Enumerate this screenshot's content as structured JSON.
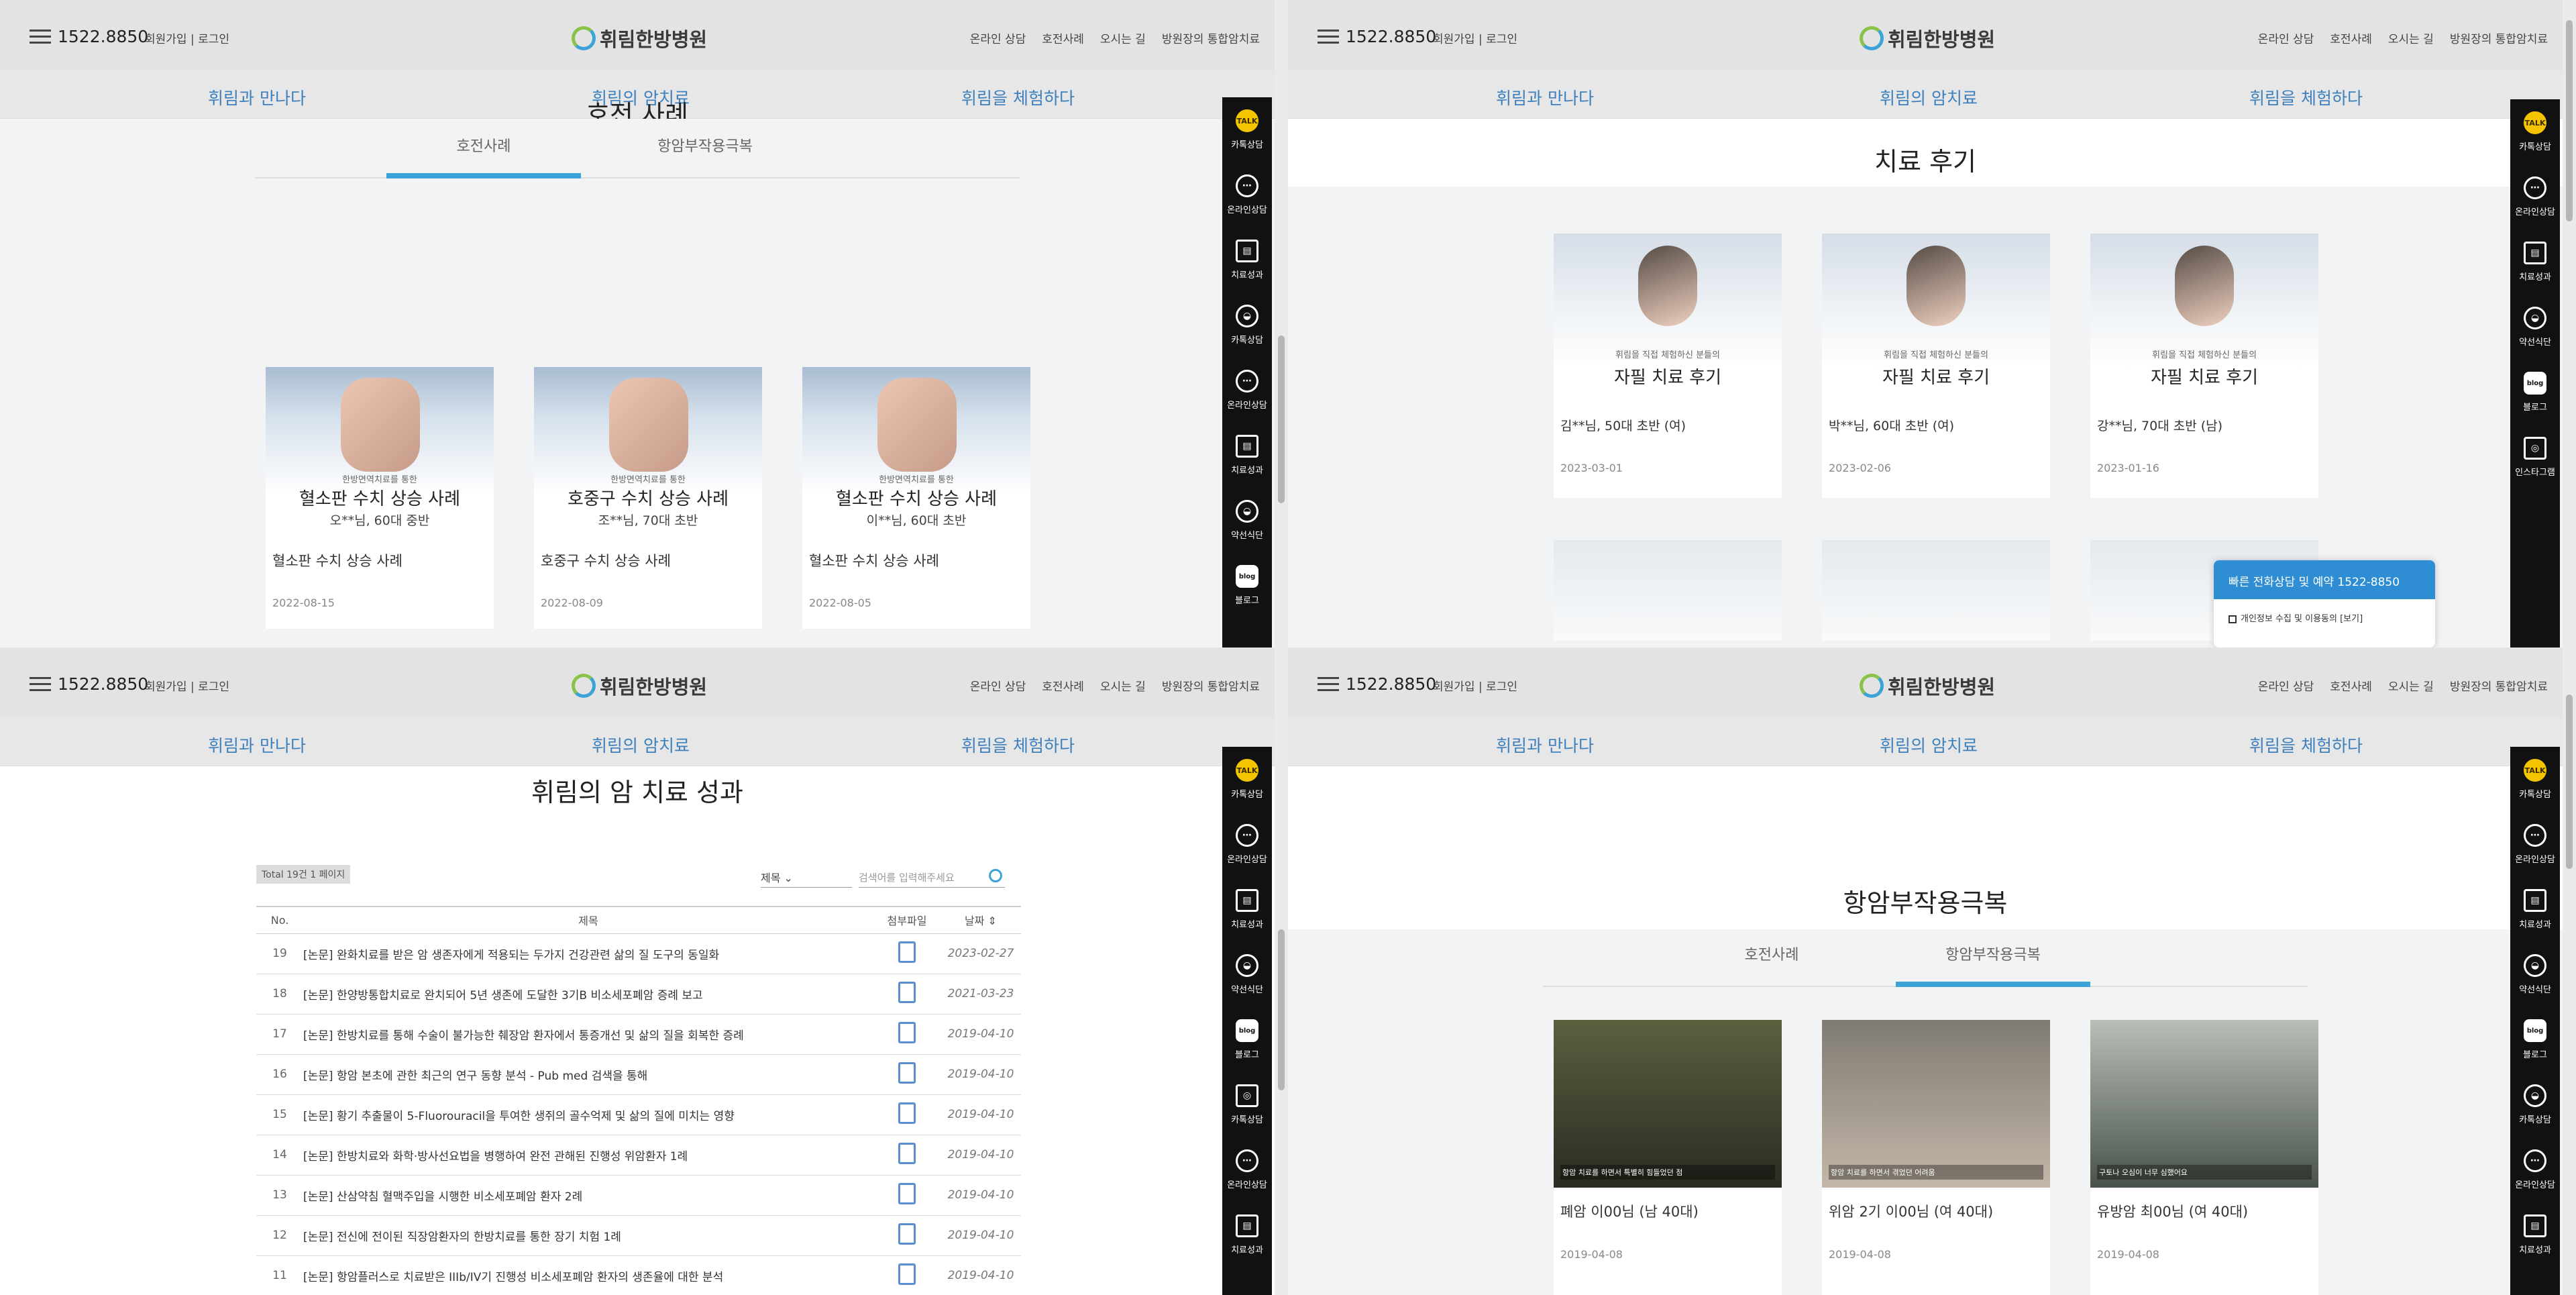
{
  "header": {
    "phone": "1522.8850",
    "member": "회원가입 | 로그인",
    "logo": "휘림한방병원",
    "logo_mark": "leaf-circle-logo",
    "top_links": [
      "온라인 상담",
      "호전사례",
      "오시는 길",
      "방원장의 통합암치료"
    ],
    "main_nav": [
      "휘림과 만나다",
      "휘림의 암치료",
      "휘림을 체험하다"
    ]
  },
  "sidebar": {
    "items": [
      {
        "icon": "TALK",
        "label": "카톡상담"
      },
      {
        "icon": "⋯",
        "label": "온라인상담"
      },
      {
        "icon": "▤",
        "label": "치료성과"
      },
      {
        "icon": "◒",
        "label": "카톡상담"
      },
      {
        "icon": "⋯",
        "label": "온라인상담"
      },
      {
        "icon": "▤",
        "label": "치료성과"
      },
      {
        "icon": "◒",
        "label": "약선식단"
      },
      {
        "icon": "blog",
        "label": "블로그"
      },
      {
        "icon": "◎",
        "label": "인스타그램"
      }
    ]
  },
  "q1": {
    "title": "호전 사례",
    "tabs": [
      "호전사례",
      "항암부작용극복"
    ],
    "cards": [
      {
        "small": "한방면역치료를 통한",
        "big": "혈소판 수치 상승 사례",
        "sub": "오**님, 60대 중반",
        "line": "혈소판 수치 상승 사례",
        "date": "2022-08-15"
      },
      {
        "small": "한방면역치료를 통한",
        "big": "호중구 수치 상승 사례",
        "sub": "조**님, 70대 초반",
        "line": "호중구 수치 상승 사례",
        "date": "2022-08-09"
      },
      {
        "small": "한방면역치료를 통한",
        "big": "혈소판 수치 상승 사례",
        "sub": "이**님, 60대 초반",
        "line": "혈소판 수치 상승 사례",
        "date": "2022-08-05"
      }
    ]
  },
  "q2": {
    "title": "치료 후기",
    "cards": [
      {
        "small": "휘림을 직접 체험하신 분들의",
        "big": "자필 치료 후기",
        "sub": "김**님, 50대 초반 (여)",
        "date": "2023-03-01"
      },
      {
        "small": "휘림을 직접 체험하신 분들의",
        "big": "자필 치료 후기",
        "sub": "박**님, 60대 초반 (여)",
        "date": "2023-02-06"
      },
      {
        "small": "휘림을 직접 체험하신 분들의",
        "big": "자필 치료 후기",
        "sub": "강**님, 70대 초반 (남)",
        "date": "2023-01-16"
      }
    ],
    "popup": {
      "title": "빠른 전화상담 및 예약 1522-8850",
      "consent": "개인정보 수집 및 이용동의 [보기]"
    }
  },
  "q3": {
    "title": "휘림의 암 치료 성과",
    "total": "Total 19건 1 페이지",
    "select": "제목",
    "search_placeholder": "검색어를 입력해주세요",
    "columns": [
      "No.",
      "제목",
      "첨부파일",
      "날짜 ⇕"
    ],
    "rows": [
      {
        "no": "19",
        "title": "[논문] 완화치료를 받은 암 생존자에게 적용되는 두가지 건강관련 삶의 질 도구의 동일화",
        "date": "2023-02-27"
      },
      {
        "no": "18",
        "title": "[논문] 한양방통합치료로 완치되어 5년 생존에 도달한 3기B 비소세포폐암 증례 보고",
        "date": "2021-03-23"
      },
      {
        "no": "17",
        "title": "[논문] 한방치료를 통해 수술이 불가능한 췌장암 환자에서 통증개선 및 삶의 질을 회복한 증례",
        "date": "2019-04-10"
      },
      {
        "no": "16",
        "title": "[논문] 항암 본초에 관한 최근의 연구 동향 분석 - Pub med 검색을 통해",
        "date": "2019-04-10"
      },
      {
        "no": "15",
        "title": "[논문] 황기 추출물이 5-Fluorouracil을 투여한 생쥐의 골수억제 및 삶의 질에 미치는 영향",
        "date": "2019-04-10"
      },
      {
        "no": "14",
        "title": "[논문] 한방치료와 화학·방사선요법을 병행하여 완전 관해된 진행성 위암환자 1례",
        "date": "2019-04-10"
      },
      {
        "no": "13",
        "title": "[논문] 산삼약침 혈맥주입을 시행한 비소세포폐암 환자 2례",
        "date": "2019-04-10"
      },
      {
        "no": "12",
        "title": "[논문] 전신에 전이된 직장암환자의 한방치료를 통한 장기 치험 1례",
        "date": "2019-04-10"
      },
      {
        "no": "11",
        "title": "[논문] 항암플러스로 치료받은 IIIb/IV기 진행성 비소세포폐암 환자의 생존율에 대한 분석",
        "date": "2019-04-10"
      }
    ]
  },
  "q4": {
    "title": "항암부작용극복",
    "tabs": [
      "호전사례",
      "항암부작용극복"
    ],
    "cards": [
      {
        "caption": "항암 치료를 하면서 특별히 힘들었던 점",
        "name": "폐암 이00님 (남 40대)",
        "date": "2019-04-08"
      },
      {
        "caption": "항암 치료를 하면서 겪었던 어려움",
        "name": "위암 2기 이00님 (여 40대)",
        "date": "2019-04-08"
      },
      {
        "caption": "구토나 오심이 너무 심했어요",
        "name": "유방암 최00님 (여 40대)",
        "date": "2019-04-08"
      }
    ]
  }
}
